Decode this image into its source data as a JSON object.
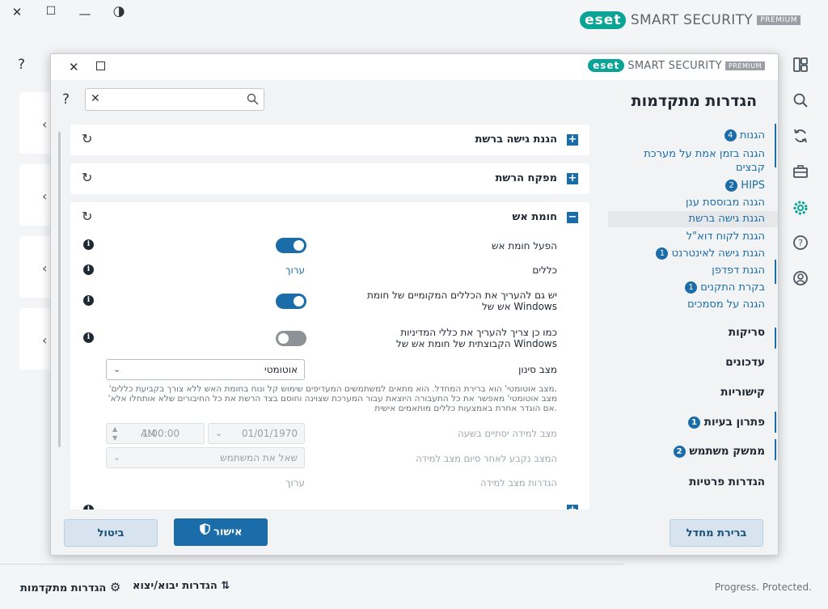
{
  "window": {
    "controls": {
      "close": "✕",
      "maximize": "☐",
      "minimize": "—",
      "contrast": "◑"
    },
    "help": "?",
    "logo": {
      "mark": "eset",
      "product": "SMART SECURITY",
      "edition": "PREMIUM"
    }
  },
  "sidebar_icons": [
    "dashboard-icon",
    "search-icon",
    "update-icon",
    "toolbox-icon",
    "settings-icon",
    "help-icon",
    "account-icon"
  ],
  "dialog": {
    "logo": {
      "mark": "eset",
      "product": "SMART SECURITY",
      "edition": "PREMIUM"
    },
    "heading": "הגדרות מתקדמות",
    "search": {
      "placeholder": "",
      "help": "?"
    },
    "nav": {
      "protections": {
        "label": "הגנות",
        "badge": "4"
      },
      "items": [
        {
          "label": "הגנה בזמן אמת על מערכת"
        },
        {
          "label": "קבצים"
        },
        {
          "label": "HIPS",
          "badge": "2"
        },
        {
          "label": "הגנה מבוססת ענן"
        },
        {
          "label": "הגנת גישה ברשת"
        },
        {
          "label": "הגנת לקוח דוא\"ל"
        },
        {
          "label": "הגנת גישה לאינטרנט",
          "badge": "1"
        },
        {
          "label": "הגנת דפדפן"
        },
        {
          "label": "בקרת התקנים",
          "badge": "1"
        },
        {
          "label": "הגנה על מסמכים"
        }
      ],
      "sections": [
        {
          "label": "סריקות"
        },
        {
          "label": "עדכונים"
        },
        {
          "label": "קישוריות"
        },
        {
          "label": "פתרון בעיות",
          "badge": "1"
        },
        {
          "label": "ממשק משתמש",
          "badge": "2"
        },
        {
          "label": "הגדרות פרטיות"
        }
      ]
    },
    "panels": {
      "network_access": {
        "title": "הגנת גישה ברשת"
      },
      "network_inspector": {
        "title": "מפקח הרשת"
      },
      "firewall": {
        "title": "חומת אש",
        "expand_icon": "−",
        "enable_label": "הפעל חומת אש",
        "rules_label": "כללים",
        "rules_edit": "ערוך",
        "local_rules_line1": "יש גם להעריך את הכללים המקומיים של חומת",
        "local_rules_line2": "אש של Windows",
        "group_policy_line1": "כמו כן צריך להעריך את כללי המדיניות",
        "group_policy_line2": "הקבוצתית של חומת אש של Windows",
        "filter_mode_label": "מצב סינון",
        "filter_mode_value": "אוטומטי",
        "desc_line1": "'מצב אוטומטי' הוא ברירת המחדל. הוא מתאים למשתמשים המעדיפים שימוש קל ונוח בחומת האש ללא צורך בקביעת כללים.",
        "desc_line2": "'מצב אוטומטי' מאפשר את כל התעבורה היוצאת עבור המערכת שצוינה וחוסם בצד הרשת את כל החיבורים שלא אותחלו אלא",
        "desc_line3": "אם הוגדר אחרת באמצעות כללים מותאמים אישית.",
        "learning_end_label": "מצב למידה יסתיים בשעה",
        "learning_date": "01/01/1970",
        "learning_time": "1:00:00",
        "learning_ampm": "AM",
        "after_learning_label": "המצב נקבע לאחר סיום מצב למידה",
        "after_learning_value": "שאל את המשתמש",
        "learning_settings_label": "הגדרות מצב למידה",
        "learning_settings_edit": "ערוך"
      }
    },
    "buttons": {
      "default": "ברירת מחדל",
      "ok": "אישור",
      "cancel": "ביטול"
    }
  },
  "footer": {
    "advanced": "הגדרות מתקדמות",
    "import_export": "הגדרות יבוא/יצוא",
    "tagline": "Progress. Protected."
  }
}
